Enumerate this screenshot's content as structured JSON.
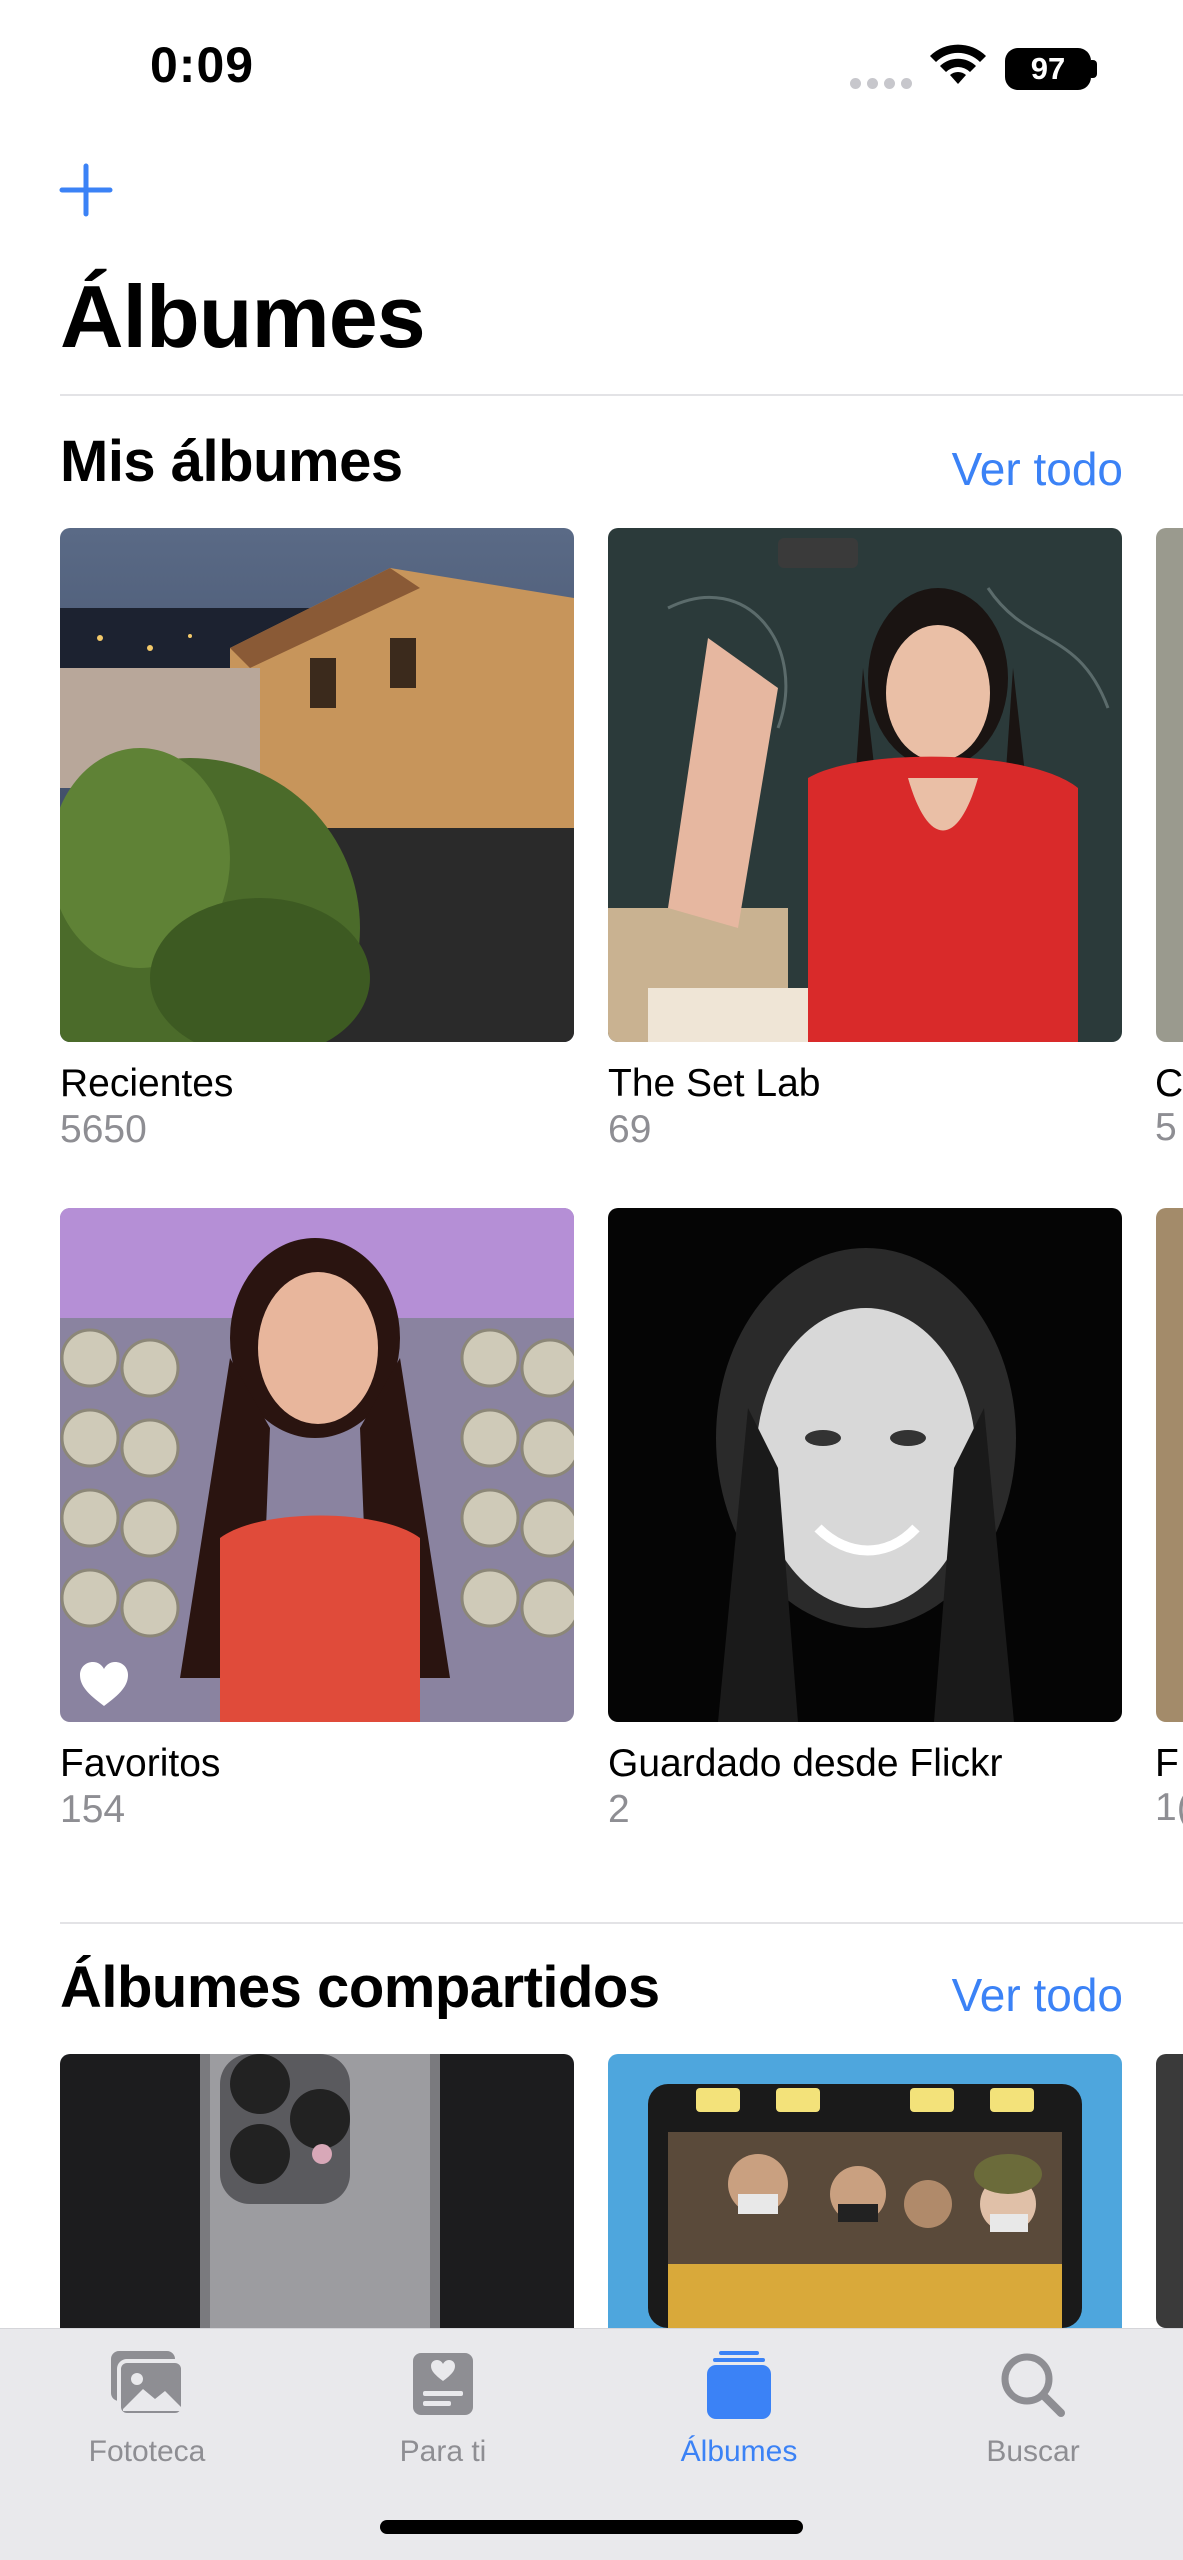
{
  "status_bar": {
    "time": "0:09",
    "battery": "97"
  },
  "header": {
    "title": "Álbumes"
  },
  "my_albums": {
    "title": "Mis álbumes",
    "see_all": "Ver todo",
    "albums": [
      {
        "name": "Recientes",
        "count": "5650"
      },
      {
        "name": "The Set Lab",
        "count": "69"
      },
      {
        "name": "C",
        "count": "5"
      },
      {
        "name": "Favoritos",
        "count": "154"
      },
      {
        "name": "Guardado desde Flickr",
        "count": "2"
      },
      {
        "name": "F",
        "count": "1("
      }
    ]
  },
  "shared_albums": {
    "title": "Álbumes compartidos",
    "see_all": "Ver todo"
  },
  "tab_bar": {
    "tabs": [
      {
        "label": "Fototeca",
        "icon": "photo-library-icon"
      },
      {
        "label": "Para ti",
        "icon": "for-you-icon"
      },
      {
        "label": "Álbumes",
        "icon": "albums-icon"
      },
      {
        "label": "Buscar",
        "icon": "search-icon"
      }
    ],
    "active": "Álbumes"
  },
  "colors": {
    "accent": "#3b82f6",
    "secondary_text": "#8e8e93",
    "tab_bar_bg": "#e9e9ec"
  }
}
